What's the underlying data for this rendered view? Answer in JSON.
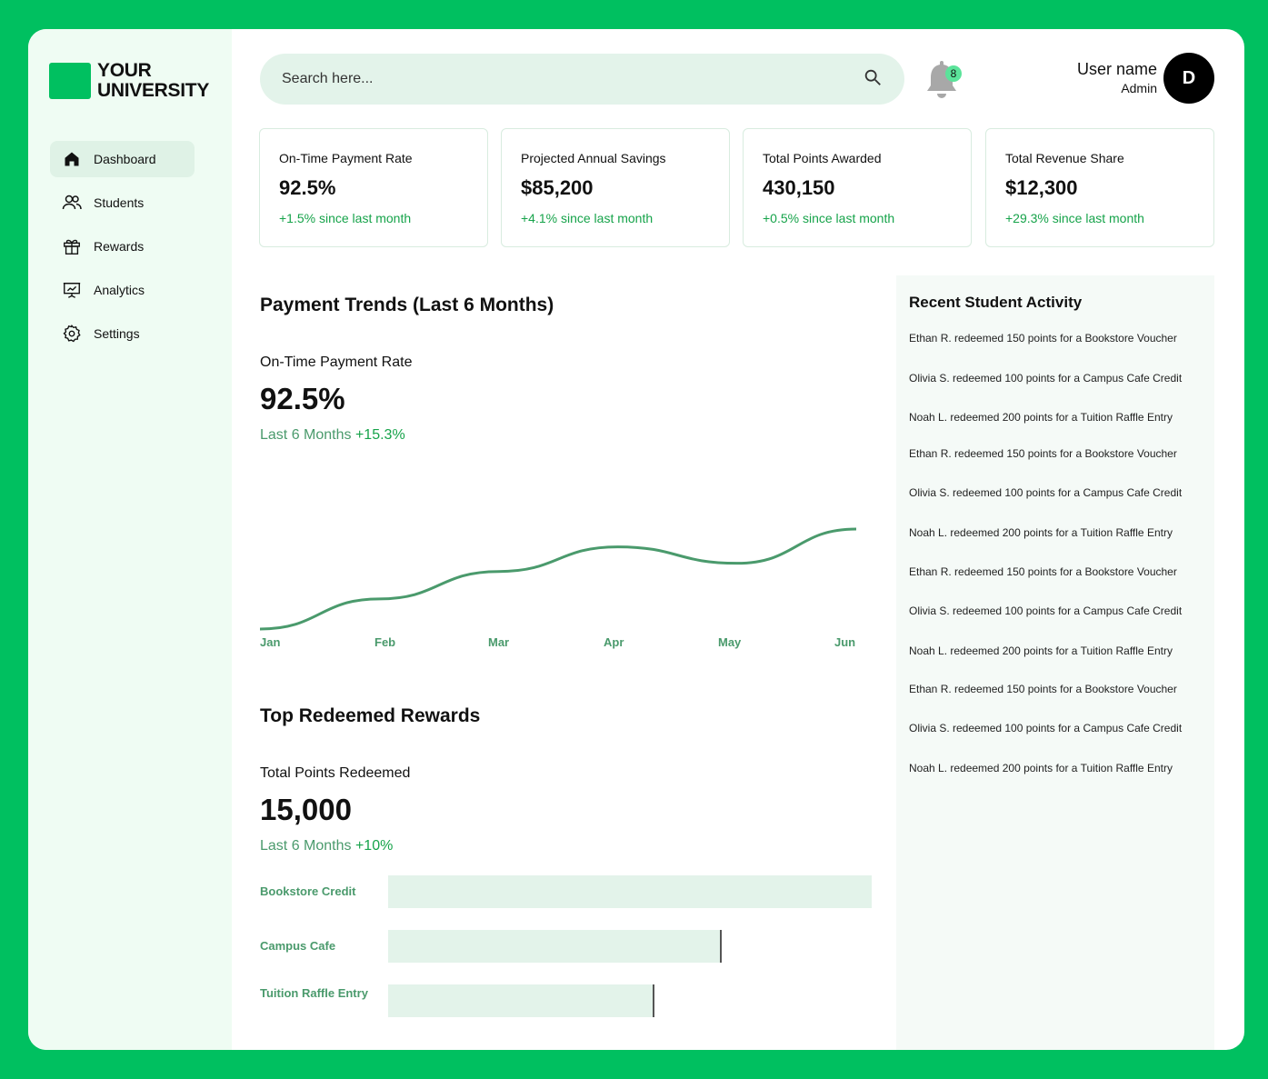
{
  "brand": {
    "line1": "YOUR",
    "line2": "UNIVERSITY"
  },
  "nav": [
    {
      "label": "Dashboard",
      "icon": "home-icon",
      "active": true
    },
    {
      "label": "Students",
      "icon": "users-icon"
    },
    {
      "label": "Rewards",
      "icon": "gift-icon"
    },
    {
      "label": "Analytics",
      "icon": "presentation-chart-icon"
    },
    {
      "label": "Settings",
      "icon": "gear-icon"
    }
  ],
  "search": {
    "placeholder": "Search here..."
  },
  "notifications": {
    "count": "8"
  },
  "user": {
    "name": "User name",
    "role": "Admin",
    "initial": "D"
  },
  "stats": [
    {
      "title": "On-Time Payment Rate",
      "value": "92.5%",
      "change": "+1.5% since last month"
    },
    {
      "title": "Projected Annual Savings",
      "value": "$85,200",
      "change": "+4.1% since last month"
    },
    {
      "title": "Total Points Awarded",
      "value": "430,150",
      "change": "+0.5% since last month"
    },
    {
      "title": "Total Revenue Share",
      "value": "$12,300",
      "change": "+29.3% since last month"
    }
  ],
  "trends": {
    "title": "Payment Trends (Last 6 Months)",
    "metric_label": "On-Time Payment Rate",
    "metric_value": "92.5%",
    "period": "Last 6 Months",
    "delta": "+15.3%"
  },
  "rewards": {
    "title": "Top Redeemed Rewards",
    "metric_label": "Total Points Redeemed",
    "metric_value": "15,000",
    "period": "Last 6 Months",
    "delta": "+10%"
  },
  "chart_data": [
    {
      "type": "line",
      "x": [
        "Jan",
        "Feb",
        "Mar",
        "Apr",
        "May",
        "Jun"
      ],
      "values": [
        0,
        22,
        42,
        60,
        48,
        73
      ],
      "line_color": "#4a9a6c",
      "grid": false
    },
    {
      "type": "bar",
      "orientation": "horizontal",
      "categories": [
        "Bookstore Credit",
        "Campus Cafe",
        "Tuition Raffle Entry"
      ],
      "values": [
        1.0,
        0.69,
        0.55
      ],
      "bar_color": "#e3f3ea"
    }
  ],
  "activity": {
    "title": "Recent Student Activity",
    "items": [
      "Ethan R. redeemed 150 points for a Bookstore Voucher",
      "Olivia S. redeemed 100 points for a Campus Cafe Credit",
      "Noah L. redeemed 200 points for a Tuition Raffle Entry",
      "Ethan R. redeemed 150 points for a Bookstore Voucher",
      "Olivia S. redeemed 100 points for a Campus Cafe Credit",
      "Noah L. redeemed 200 points for a Tuition Raffle Entry",
      "Ethan R. redeemed 150 points for a Bookstore Voucher",
      "Olivia S. redeemed 100 points for a Campus Cafe Credit",
      "Noah L. redeemed 200 points for a Tuition Raffle Entry",
      "Ethan R. redeemed 150 points for a Bookstore Voucher",
      "Olivia S. redeemed 100 points for a Campus Cafe Credit",
      "Noah L. redeemed 200 points for a Tuition Raffle Entry"
    ]
  },
  "colors": {
    "brand": "#00c060",
    "accent": "#4a9a6c",
    "positive": "#16a34a"
  }
}
